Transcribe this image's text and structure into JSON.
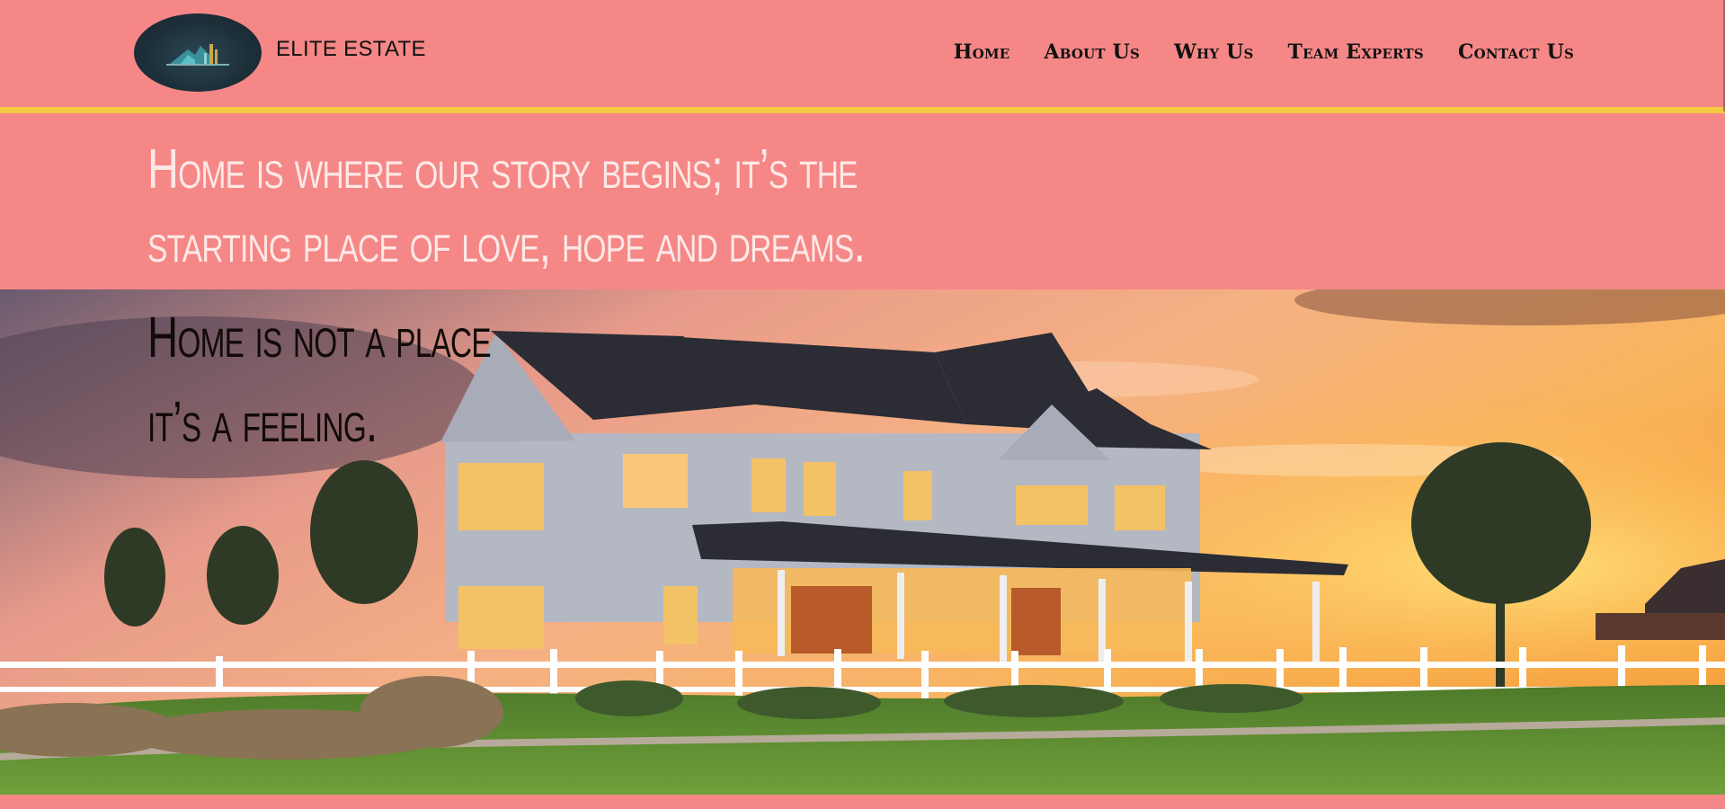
{
  "brand": {
    "name": "ELITE ESTATE",
    "logo_icon": "house-logo-icon"
  },
  "nav": {
    "items": [
      {
        "label": "Home"
      },
      {
        "label": "About Us"
      },
      {
        "label": "Why Us"
      },
      {
        "label": "Team Experts"
      },
      {
        "label": "Contact Us"
      }
    ]
  },
  "hero": {
    "lines": [
      "Home is where our story begins; it’s the",
      "starting place of love, hope and dreams."
    ]
  },
  "feature": {
    "image": "house-at-sunset-photo",
    "lines": [
      "Home is not a place",
      "it’s a feeling."
    ]
  },
  "colors": {
    "background": "#f58787",
    "accent_line": "#f5c842",
    "hero_text": "#fde9e6"
  }
}
